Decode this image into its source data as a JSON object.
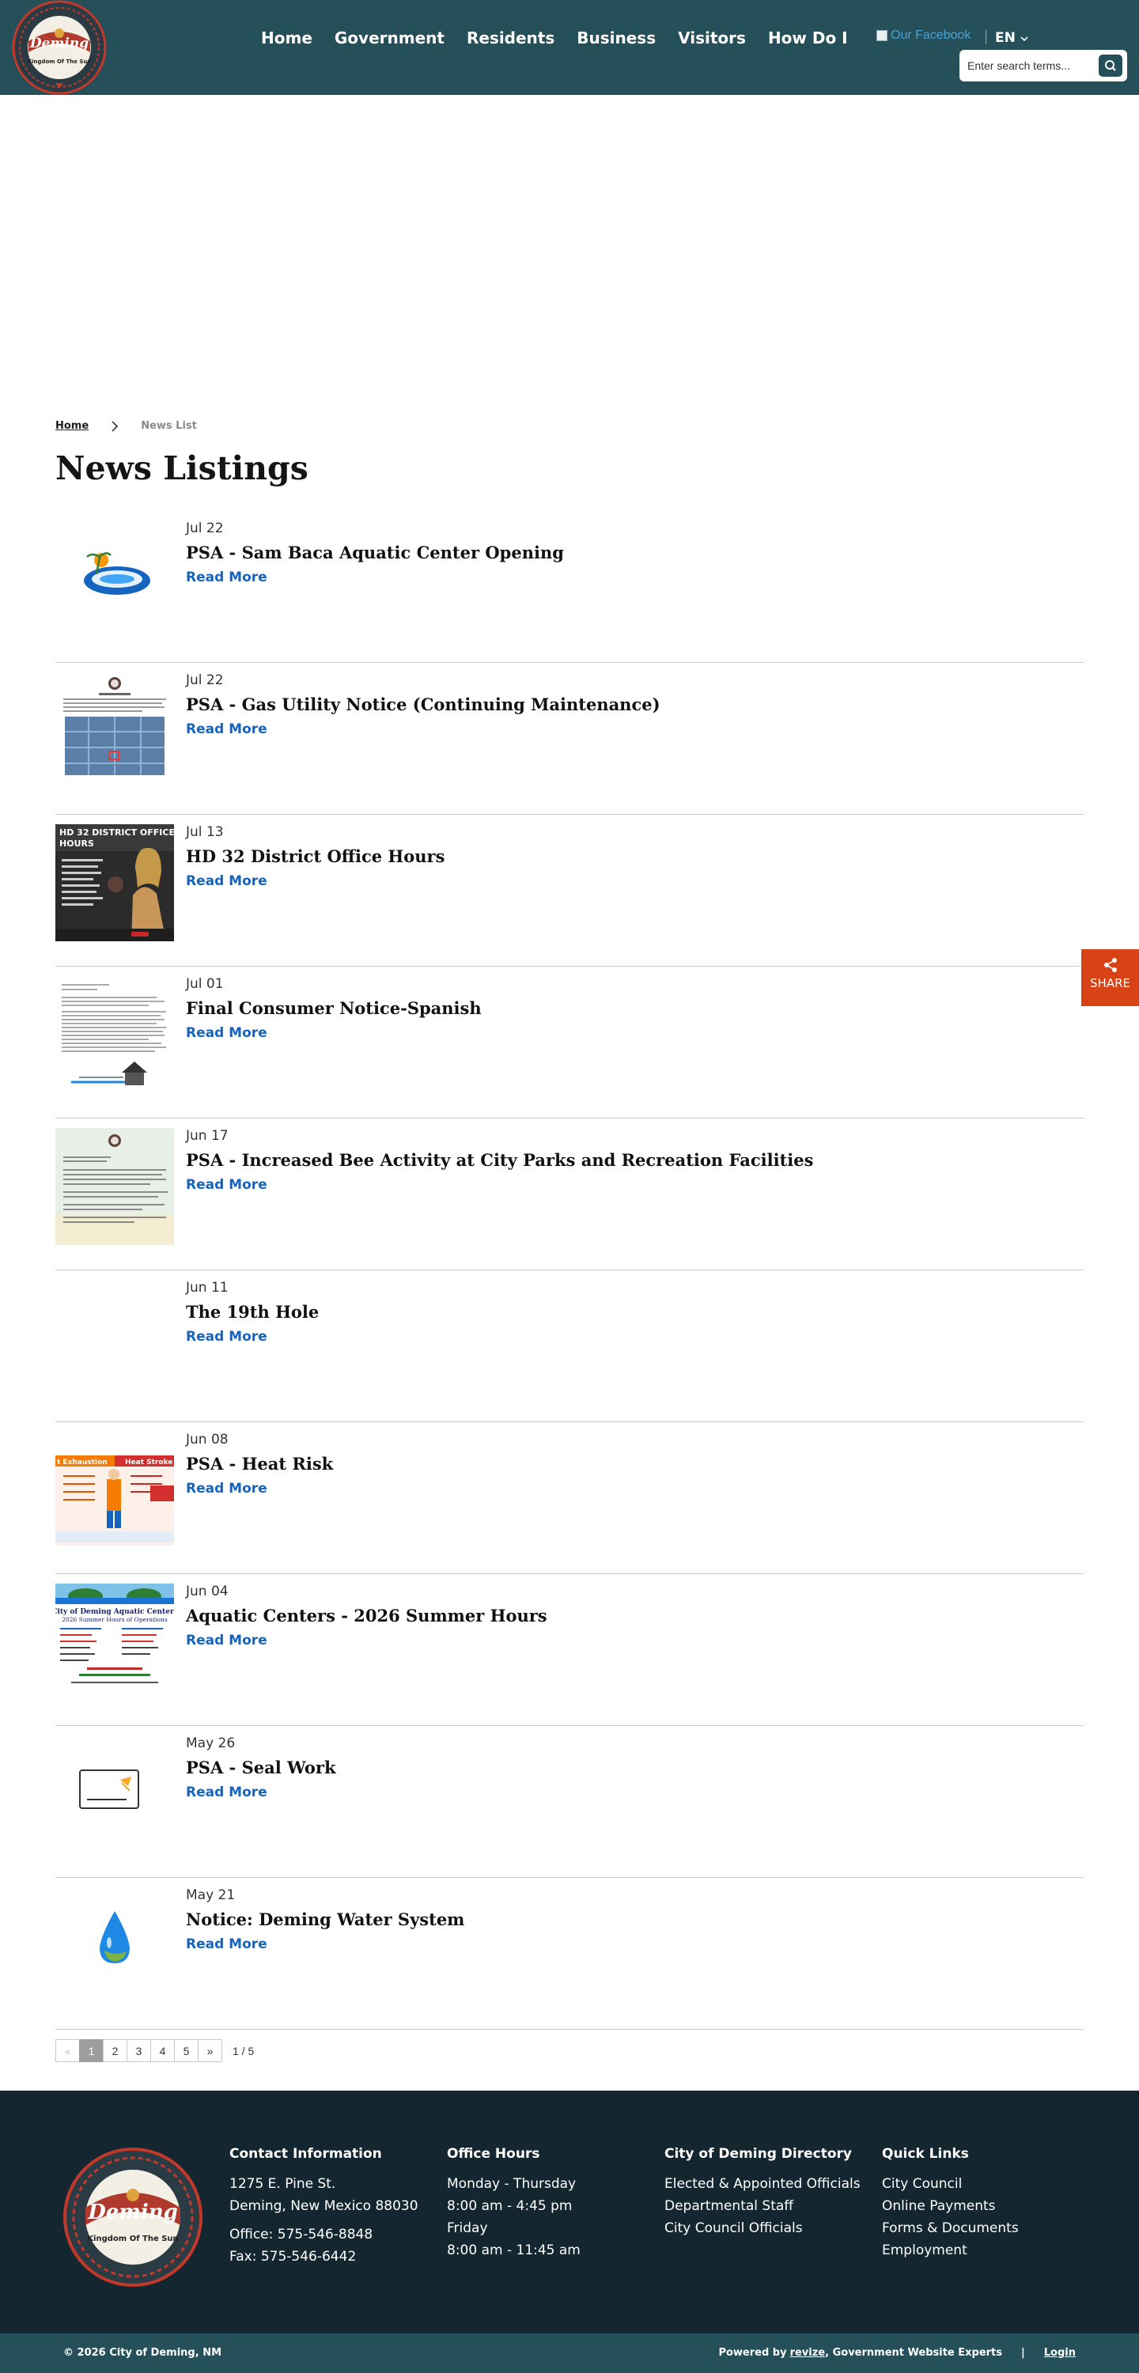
{
  "header": {
    "logo_text": "Deming Kingdom Of The Sun",
    "nav": [
      "Home",
      "Government",
      "Residents",
      "Business",
      "Visitors",
      "How Do I"
    ],
    "social_alt": "Our Facebook",
    "language": "EN",
    "search_placeholder": "Enter search terms..."
  },
  "breadcrumb": {
    "home": "Home",
    "current": "News List"
  },
  "page_title": "News Listings",
  "news": [
    {
      "date": "Jul 22",
      "title": "PSA - Sam Baca Aquatic Center Opening",
      "more": "Read More",
      "thumb": "pool-icon"
    },
    {
      "date": "Jul 22",
      "title": "PSA - Gas Utility Notice (Continuing Maintenance)",
      "more": "Read More",
      "thumb": "map-notice"
    },
    {
      "date": "Jul 13",
      "title": "HD 32 District Office Hours",
      "more": "Read More",
      "thumb": "flyer"
    },
    {
      "date": "Jul 01",
      "title": "Final Consumer Notice-Spanish",
      "more": "Read More",
      "thumb": "document"
    },
    {
      "date": "Jun 17",
      "title": "PSA - Increased Bee Activity at City Parks and Recreation Facilities",
      "more": "Read More",
      "thumb": "notice"
    },
    {
      "date": "Jun 11",
      "title": "The 19th Hole",
      "more": "Read More",
      "thumb": "none"
    },
    {
      "date": "Jun 08",
      "title": "PSA - Heat Risk",
      "more": "Read More",
      "thumb": "heat"
    },
    {
      "date": "Jun 04",
      "title": "Aquatic Centers - 2026 Summer Hours",
      "more": "Read More",
      "thumb": "aquatic"
    },
    {
      "date": "May 26",
      "title": "PSA - Seal Work",
      "more": "Read More",
      "thumb": "public-notice"
    },
    {
      "date": "May 21",
      "title": "Notice: Deming Water System",
      "more": "Read More",
      "thumb": "water-drop"
    }
  ],
  "pagination": {
    "prev": "«",
    "pages": [
      "1",
      "2",
      "3",
      "4",
      "5"
    ],
    "next": "»",
    "count": "1 / 5"
  },
  "footer": {
    "contact": {
      "heading": "Contact Information",
      "lines": [
        "1275 E. Pine St.",
        "Deming, New Mexico 88030",
        "Office: 575-546-8848",
        "Fax: 575-546-6442"
      ]
    },
    "hours": {
      "heading": "Office Hours",
      "lines": [
        "Monday - Thursday",
        "8:00 am - 4:45 pm",
        "Friday",
        "8:00 am - 11:45 am"
      ]
    },
    "directory": {
      "heading": "City of Deming Directory",
      "links": [
        "Elected & Appointed Officials",
        "Departmental Staff",
        "City Council Officials"
      ]
    },
    "quick": {
      "heading": "Quick Links",
      "links": [
        "City Council",
        "Online Payments",
        "Forms & Documents",
        "Employment"
      ]
    }
  },
  "bottom": {
    "copyright": "© 2026 City of Deming, NM",
    "powered_pre": "Powered by",
    "powered_link": "revize",
    "powered_post": ", Government Website Experts",
    "sep": "|",
    "login": "Login"
  },
  "share": {
    "label": "SHARE"
  },
  "colors": {
    "header": "#25505a",
    "footer": "#142730",
    "link": "#1565c0",
    "share": "#d84315"
  }
}
